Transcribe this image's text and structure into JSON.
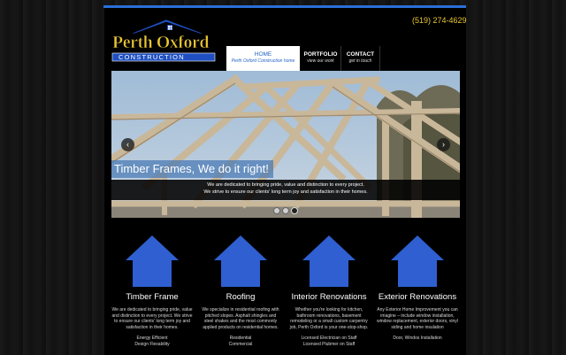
{
  "header": {
    "logo_line1": "Perth Oxford",
    "logo_line2": "CONSTRUCTION",
    "phone": "(519) 274-4629"
  },
  "nav": {
    "items": [
      {
        "label": "HOME",
        "sub": "Perth Oxford Construction home"
      },
      {
        "label": "PORTFOLIO",
        "sub": "view our work"
      },
      {
        "label": "CONTACT",
        "sub": "get in touch"
      }
    ]
  },
  "slider": {
    "caption_title": "Timber Frames, We do it right!",
    "caption_line1": "We are dedicated to bringing pride, value and distinction to every project.",
    "caption_line2": "We strive to ensure our clients' long term joy and satisfaction in their homes.",
    "prev": "‹",
    "next": "›"
  },
  "features": [
    {
      "title": "Timber Frame",
      "text": "We are dedicated to bringing pride, value and distinction to every project. We strive to ensure our clients' long term joy and satisfaction in their homes.",
      "list": [
        "Energy Efficient",
        "Design Flexability"
      ]
    },
    {
      "title": "Roofing",
      "text": "We specialize in residential roofing with pitched slopes. Asphalt shingles and steel shakes and the most commonly applied products on residential homes.",
      "list": [
        "Residential",
        "Commercial"
      ]
    },
    {
      "title": "Interior Renovations",
      "text": "Whether you're looking for kitchen, bathroom renovations, basement remodeling or a small custom carpentry job, Perth Oxford is your one-stop-shop.",
      "list": [
        "Licensed Electrician on Staff",
        "Licensed Plubmer on Staff"
      ]
    },
    {
      "title": "Exterior Renovations",
      "text": "Any Exterior Home Improvement you can imagine – include window installation, window replacement, exterior doors, vinyl siding and home insulation",
      "list": [
        "Door, Windos Installation"
      ]
    }
  ],
  "colors": {
    "accent_blue": "#2f5fd0",
    "phone_yellow": "#e9c631",
    "nav_active": "#1f62c4"
  }
}
